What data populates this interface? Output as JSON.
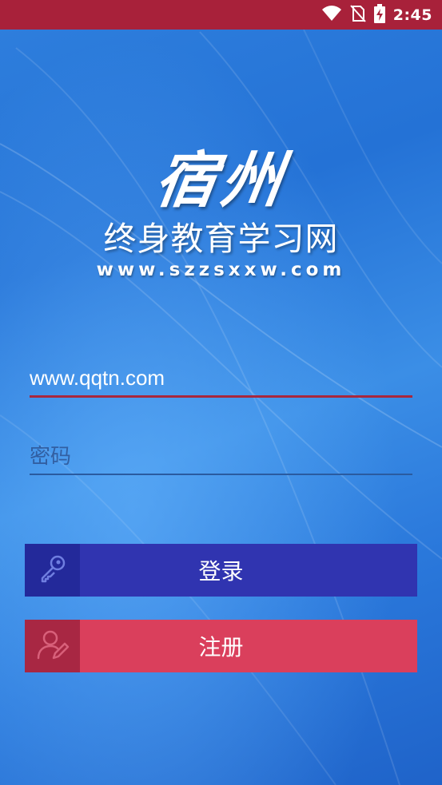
{
  "status_bar": {
    "time": "2:45",
    "icons": [
      "wifi-icon",
      "no-sim-icon",
      "battery-charging-icon"
    ],
    "background": "#a8213a"
  },
  "logo": {
    "calligraphy": "宿州",
    "title": "终身教育学习网",
    "url": "www.szzsxxw.com"
  },
  "form": {
    "username_value": "www.qqtn.com",
    "username_placeholder": "",
    "password_value": "",
    "password_placeholder": "密码"
  },
  "buttons": {
    "login": {
      "label": "登录",
      "icon": "key-icon",
      "color": "#3034b0"
    },
    "register": {
      "label": "注册",
      "icon": "user-edit-icon",
      "color": "#da3f5c"
    }
  }
}
